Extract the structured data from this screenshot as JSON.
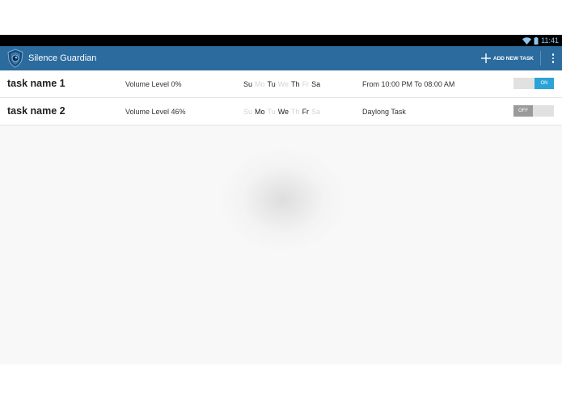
{
  "status_bar": {
    "time": "11:41",
    "icons": [
      "wifi-icon",
      "battery-icon"
    ]
  },
  "action_bar": {
    "title": "Silence Guardian",
    "app_icon": "shield-icon",
    "add_task_label": "ADD NEW TASK",
    "overflow_icon": "overflow-menu-icon",
    "color": "#2b6b9e"
  },
  "tasks": [
    {
      "name": "task name 1",
      "volume": "Volume Level 0%",
      "days": [
        {
          "label": "Su",
          "active": true
        },
        {
          "label": "Mo",
          "active": false
        },
        {
          "label": "Tu",
          "active": true
        },
        {
          "label": "We",
          "active": false
        },
        {
          "label": "Th",
          "active": true
        },
        {
          "label": "Fr",
          "active": false
        },
        {
          "label": "Sa",
          "active": true
        }
      ],
      "schedule": "From 10:00 PM To 08:00 AM",
      "toggle_label": "ON",
      "enabled": true
    },
    {
      "name": "task name 2",
      "volume": "Volume Level 46%",
      "days": [
        {
          "label": "Su",
          "active": false
        },
        {
          "label": "Mo",
          "active": true
        },
        {
          "label": "Tu",
          "active": false
        },
        {
          "label": "We",
          "active": true
        },
        {
          "label": "Th",
          "active": false
        },
        {
          "label": "Fr",
          "active": true
        },
        {
          "label": "Sa",
          "active": false
        }
      ],
      "schedule": "Daylong Task",
      "toggle_label": "OFF",
      "enabled": false
    }
  ],
  "colors": {
    "toggle_on": "#2aa3d6",
    "toggle_off": "#9a9a9a",
    "day_inactive": "#d4d4d4"
  }
}
